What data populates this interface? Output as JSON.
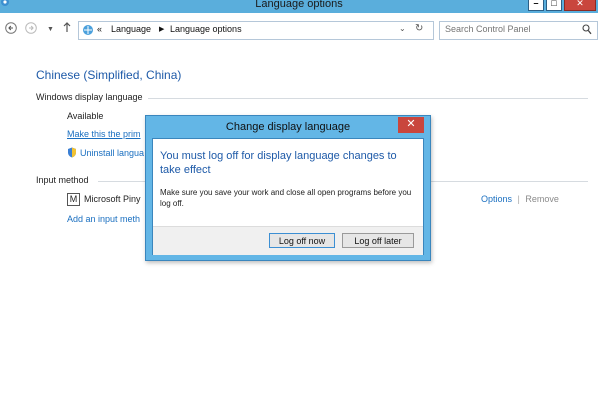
{
  "window": {
    "title": "Language options"
  },
  "navbar": {
    "address_prefix": "«",
    "crumbs": [
      "Language",
      "Language options"
    ],
    "search_placeholder": "Search Control Panel"
  },
  "content": {
    "language_name": "Chinese (Simplified, China)",
    "display_language_label": "Windows display language",
    "available_text": "Available",
    "make_primary_link": "Make this the prim",
    "uninstall_link": "Uninstall langua",
    "input_method_label": "Input method",
    "ime_glyph": "M",
    "ime_name": "Microsoft Piny",
    "add_input_link": "Add an input meth",
    "options_link": "Options",
    "separator": "|",
    "remove_link": "Remove"
  },
  "dialog": {
    "title": "Change display language",
    "close_glyph": "✕",
    "heading": "You must log off for display language changes to take effect",
    "message": "Make sure you save your work and close all open programs before you log off.",
    "logoff_now_label": "Log off now",
    "logoff_later_label": "Log off later"
  }
}
